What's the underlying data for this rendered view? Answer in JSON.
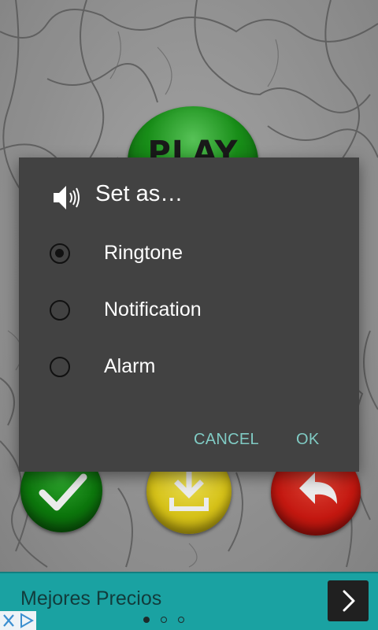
{
  "background_app": {
    "play_label": "PLAY"
  },
  "dialog": {
    "title": "Set as…",
    "title_icon": "speaker-icon",
    "options": [
      {
        "label": "Ringtone",
        "selected": true
      },
      {
        "label": "Notification",
        "selected": false
      },
      {
        "label": "Alarm",
        "selected": false
      }
    ],
    "cancel_label": "CANCEL",
    "ok_label": "OK",
    "accent_color": "#80cbc4"
  },
  "ad": {
    "text": "Mejores Precios",
    "next_icon": "chevron-right-icon",
    "close_icon": "close-icon",
    "adchoices_icon": "adchoices-icon",
    "page_dots": 3,
    "active_dot": 0,
    "banner_color": "#1aa2a2"
  }
}
